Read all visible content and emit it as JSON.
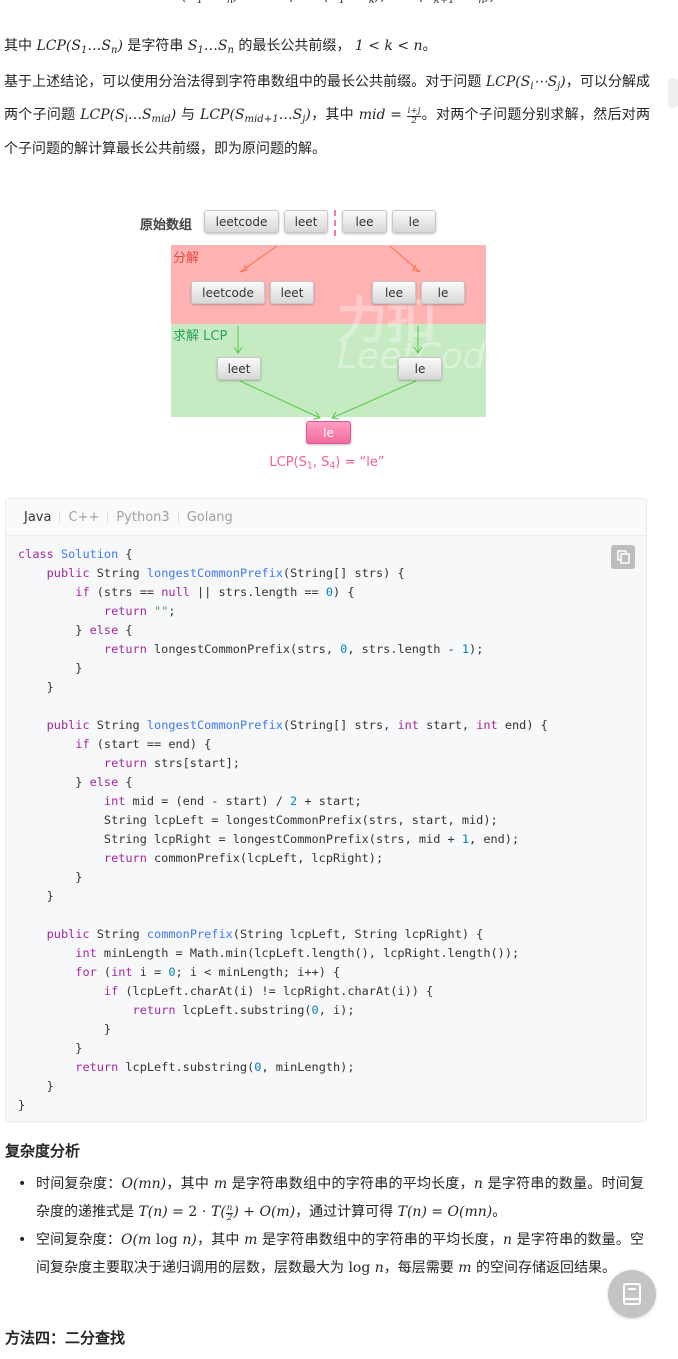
{
  "article": {
    "para1_a": "其中",
    "para1_b": "是字符串",
    "para1_c": "的最长公共前缀，",
    "para2_a": "基于上述结论，可以使用分治法得到字符串数组中的最长公共前缀。对于问题",
    "para2_b": "，可以分解成两个子问题",
    "para2_c": "与",
    "para2_d": "，其中",
    "para2_e": "。对两个子问题分别求解，然后对两个子问题的解计算最长公共前缀，即为原问题的解。"
  },
  "diagram": {
    "original_label": "原始数组",
    "words": [
      "leetcode",
      "leet",
      "lee",
      "le"
    ],
    "decompose_label": "分解",
    "solve_label": "求解 LCP",
    "mid_left": "leet",
    "mid_right": "le",
    "result": "le",
    "lcp_caption_main": "LCP(S",
    "lcp_caption_sub1": "1",
    "lcp_caption_comma": ", S",
    "lcp_caption_sub2": "4",
    "lcp_caption_tail": ") = “le”",
    "watermark_cn": "力扣",
    "watermark_en": "LeetCode"
  },
  "code": {
    "tabs": [
      "Java",
      "C++",
      "Python3",
      "Golang"
    ],
    "active_tab": "Java"
  },
  "complexity": {
    "title": "复杂度分析",
    "time_a": "时间复杂度：",
    "time_b": "，其中",
    "time_c": "是字符串数组中的字符串的平均长度，",
    "time_d": "是字符串的数量。时间复杂度的递推式是",
    "time_e": "，通过计算可得",
    "time_f": "。",
    "space_a": "空间复杂度：",
    "space_b": "，其中",
    "space_c": "是字符串数组中的字符串的平均长度，",
    "space_d": "是字符串的数量。空间复杂度主要取决于递归调用的层数，层数最大为",
    "space_e": "，每层需要",
    "space_f": "的空间存储返回结果。"
  },
  "next_section": "方法四：二分查找",
  "icons": {
    "copy": "copy-icon",
    "fab": "book-icon"
  },
  "colors": {
    "decompose_zone": "#ffb3b3",
    "solve_zone": "#c6ebc2",
    "result_node": "#f16ba0",
    "code_bg": "#f7f8fa"
  }
}
